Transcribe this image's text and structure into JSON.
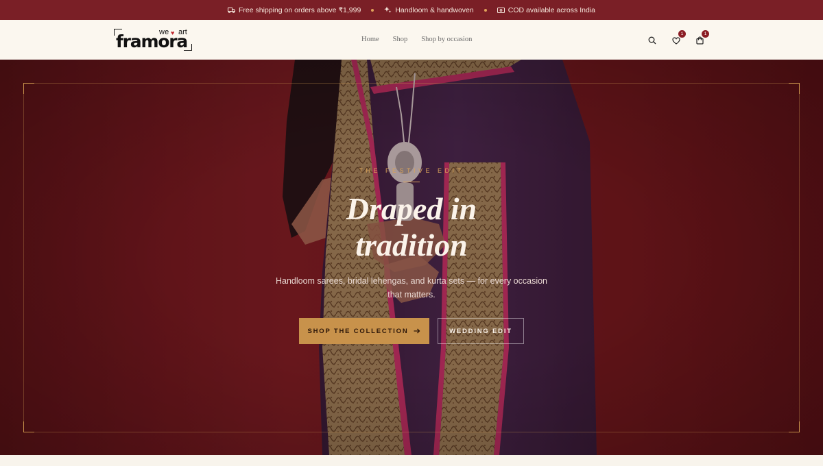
{
  "announcement": {
    "items": [
      {
        "icon": "truck-icon",
        "text": "Free shipping on orders above ₹1,999"
      },
      {
        "icon": "sparkle-icon",
        "text": "Handloom & handwoven"
      },
      {
        "icon": "cash-icon",
        "text": "COD available across India"
      }
    ],
    "bg_color": "#7a1f26",
    "dot_color": "#e0a25a"
  },
  "header": {
    "logo": {
      "we": "we",
      "heart": "♥",
      "art": "art",
      "word": "framora"
    },
    "nav": [
      {
        "label": "Home"
      },
      {
        "label": "Shop"
      },
      {
        "label": "Shop by occasion"
      }
    ],
    "icons": {
      "search": "search-icon",
      "wishlist": {
        "icon": "heart-icon",
        "count": "1"
      },
      "cart": {
        "icon": "bag-icon",
        "count": "1"
      }
    }
  },
  "hero": {
    "eyebrow": "THE FESTIVE EDIT",
    "title_line1": "Draped in",
    "title_line2": "tradition",
    "subtitle": "Handloom sarees, bridal lehengas, and kurta sets — for every occasion that matters.",
    "primary_cta": "SHOP THE COLLECTION",
    "secondary_cta": "WEDDING EDIT",
    "accent_color": "#c8924b",
    "bg_color": "#761b21"
  }
}
